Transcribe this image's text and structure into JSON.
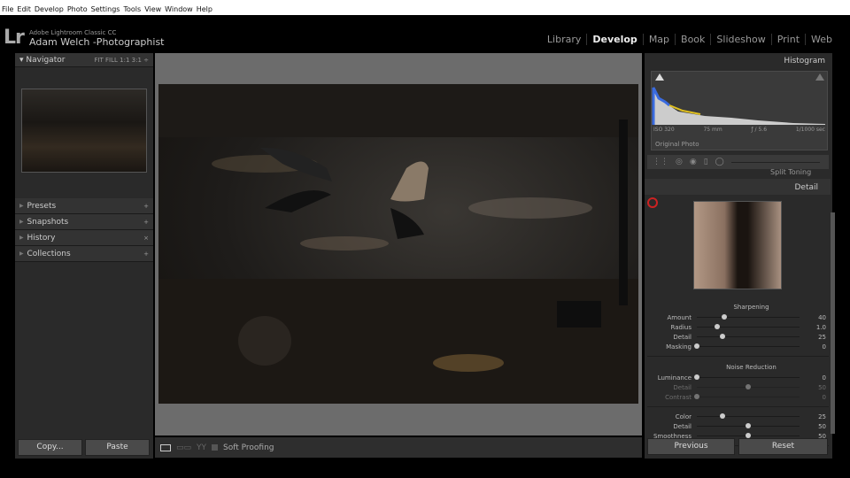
{
  "menu": [
    "File",
    "Edit",
    "Develop",
    "Photo",
    "Settings",
    "Tools",
    "View",
    "Window",
    "Help"
  ],
  "app_name": "Adobe Lightroom Classic CC",
  "logo": "Lr",
  "identity_plate": "Adam Welch -Photographist",
  "modules": [
    {
      "label": "Library"
    },
    {
      "label": "Develop",
      "active": true
    },
    {
      "label": "Map"
    },
    {
      "label": "Book"
    },
    {
      "label": "Slideshow"
    },
    {
      "label": "Print"
    },
    {
      "label": "Web"
    }
  ],
  "left": {
    "navigator": "Navigator",
    "zoom": "FIT  FILL  1:1  3:1 ÷",
    "panels": [
      {
        "label": "Presets",
        "action": "+"
      },
      {
        "label": "Snapshots",
        "action": "+"
      },
      {
        "label": "History",
        "action": "×"
      },
      {
        "label": "Collections",
        "action": "+"
      }
    ],
    "copy": "Copy...",
    "paste": "Paste"
  },
  "right": {
    "histogram": "Histogram",
    "iso": "ISO 320",
    "focal": "75 mm",
    "aperture": "ƒ / 5.6",
    "shutter": "1/1000 sec",
    "original": "Original Photo",
    "split_toning": "Split Toning",
    "detail": "Detail",
    "sharpening": {
      "title": "Sharpening",
      "sliders": [
        {
          "label": "Amount",
          "value": "40",
          "fraction": 0.27
        },
        {
          "label": "Radius",
          "value": "1.0",
          "fraction": 0.2
        },
        {
          "label": "Detail",
          "value": "25",
          "fraction": 0.25
        },
        {
          "label": "Masking",
          "value": "0",
          "fraction": 0
        }
      ]
    },
    "noise": {
      "title": "Noise Reduction",
      "sliders": [
        {
          "label": "Luminance",
          "value": "0",
          "fraction": 0
        },
        {
          "label": "Detail",
          "value": "50",
          "fraction": 0.5,
          "disabled": true
        },
        {
          "label": "Contrast",
          "value": "0",
          "fraction": 0,
          "disabled": true
        }
      ]
    },
    "color": {
      "sliders": [
        {
          "label": "Color",
          "value": "25",
          "fraction": 0.25
        },
        {
          "label": "Detail",
          "value": "50",
          "fraction": 0.5
        },
        {
          "label": "Smoothness",
          "value": "50",
          "fraction": 0.5
        }
      ]
    },
    "previous": "Previous",
    "reset": "Reset"
  },
  "toolbar": {
    "soft_proofing": "Soft Proofing"
  }
}
